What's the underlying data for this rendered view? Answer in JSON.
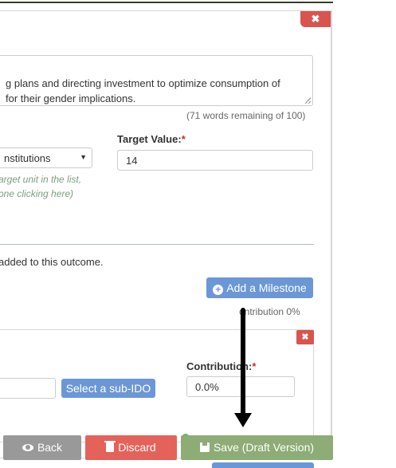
{
  "outcome": {
    "description_text": "g plans and directing investment to optimize consumption of\nfor their gender implications.",
    "words_remaining": "(71 words remaining of 100)",
    "target_value_label": "Target Value:",
    "required_mark": "*",
    "target_unit_selected": "nstitutions",
    "target_value": "14",
    "unit_hint": "arget unit in the list,\none clicking here)"
  },
  "milestones": {
    "empty_text": "added to this outcome.",
    "add_button_label": "Add a Milestone",
    "plus_icon": "plus-circle-icon",
    "contribution_total": "ontribution 0%"
  },
  "subido": {
    "select_button_label": "Select a sub-IDO",
    "contribution_label": "Contribution:",
    "contribution_value": "0.0%"
  },
  "close_label": "✖",
  "footer": {
    "back_label": "Back",
    "discard_label": "Discard",
    "save_label": "Save (Draft Version)"
  },
  "colors": {
    "danger": "#d9534f",
    "primary": "#6c97d6",
    "save": "#8dac76",
    "back": "#999999",
    "discard": "#e4625a"
  }
}
